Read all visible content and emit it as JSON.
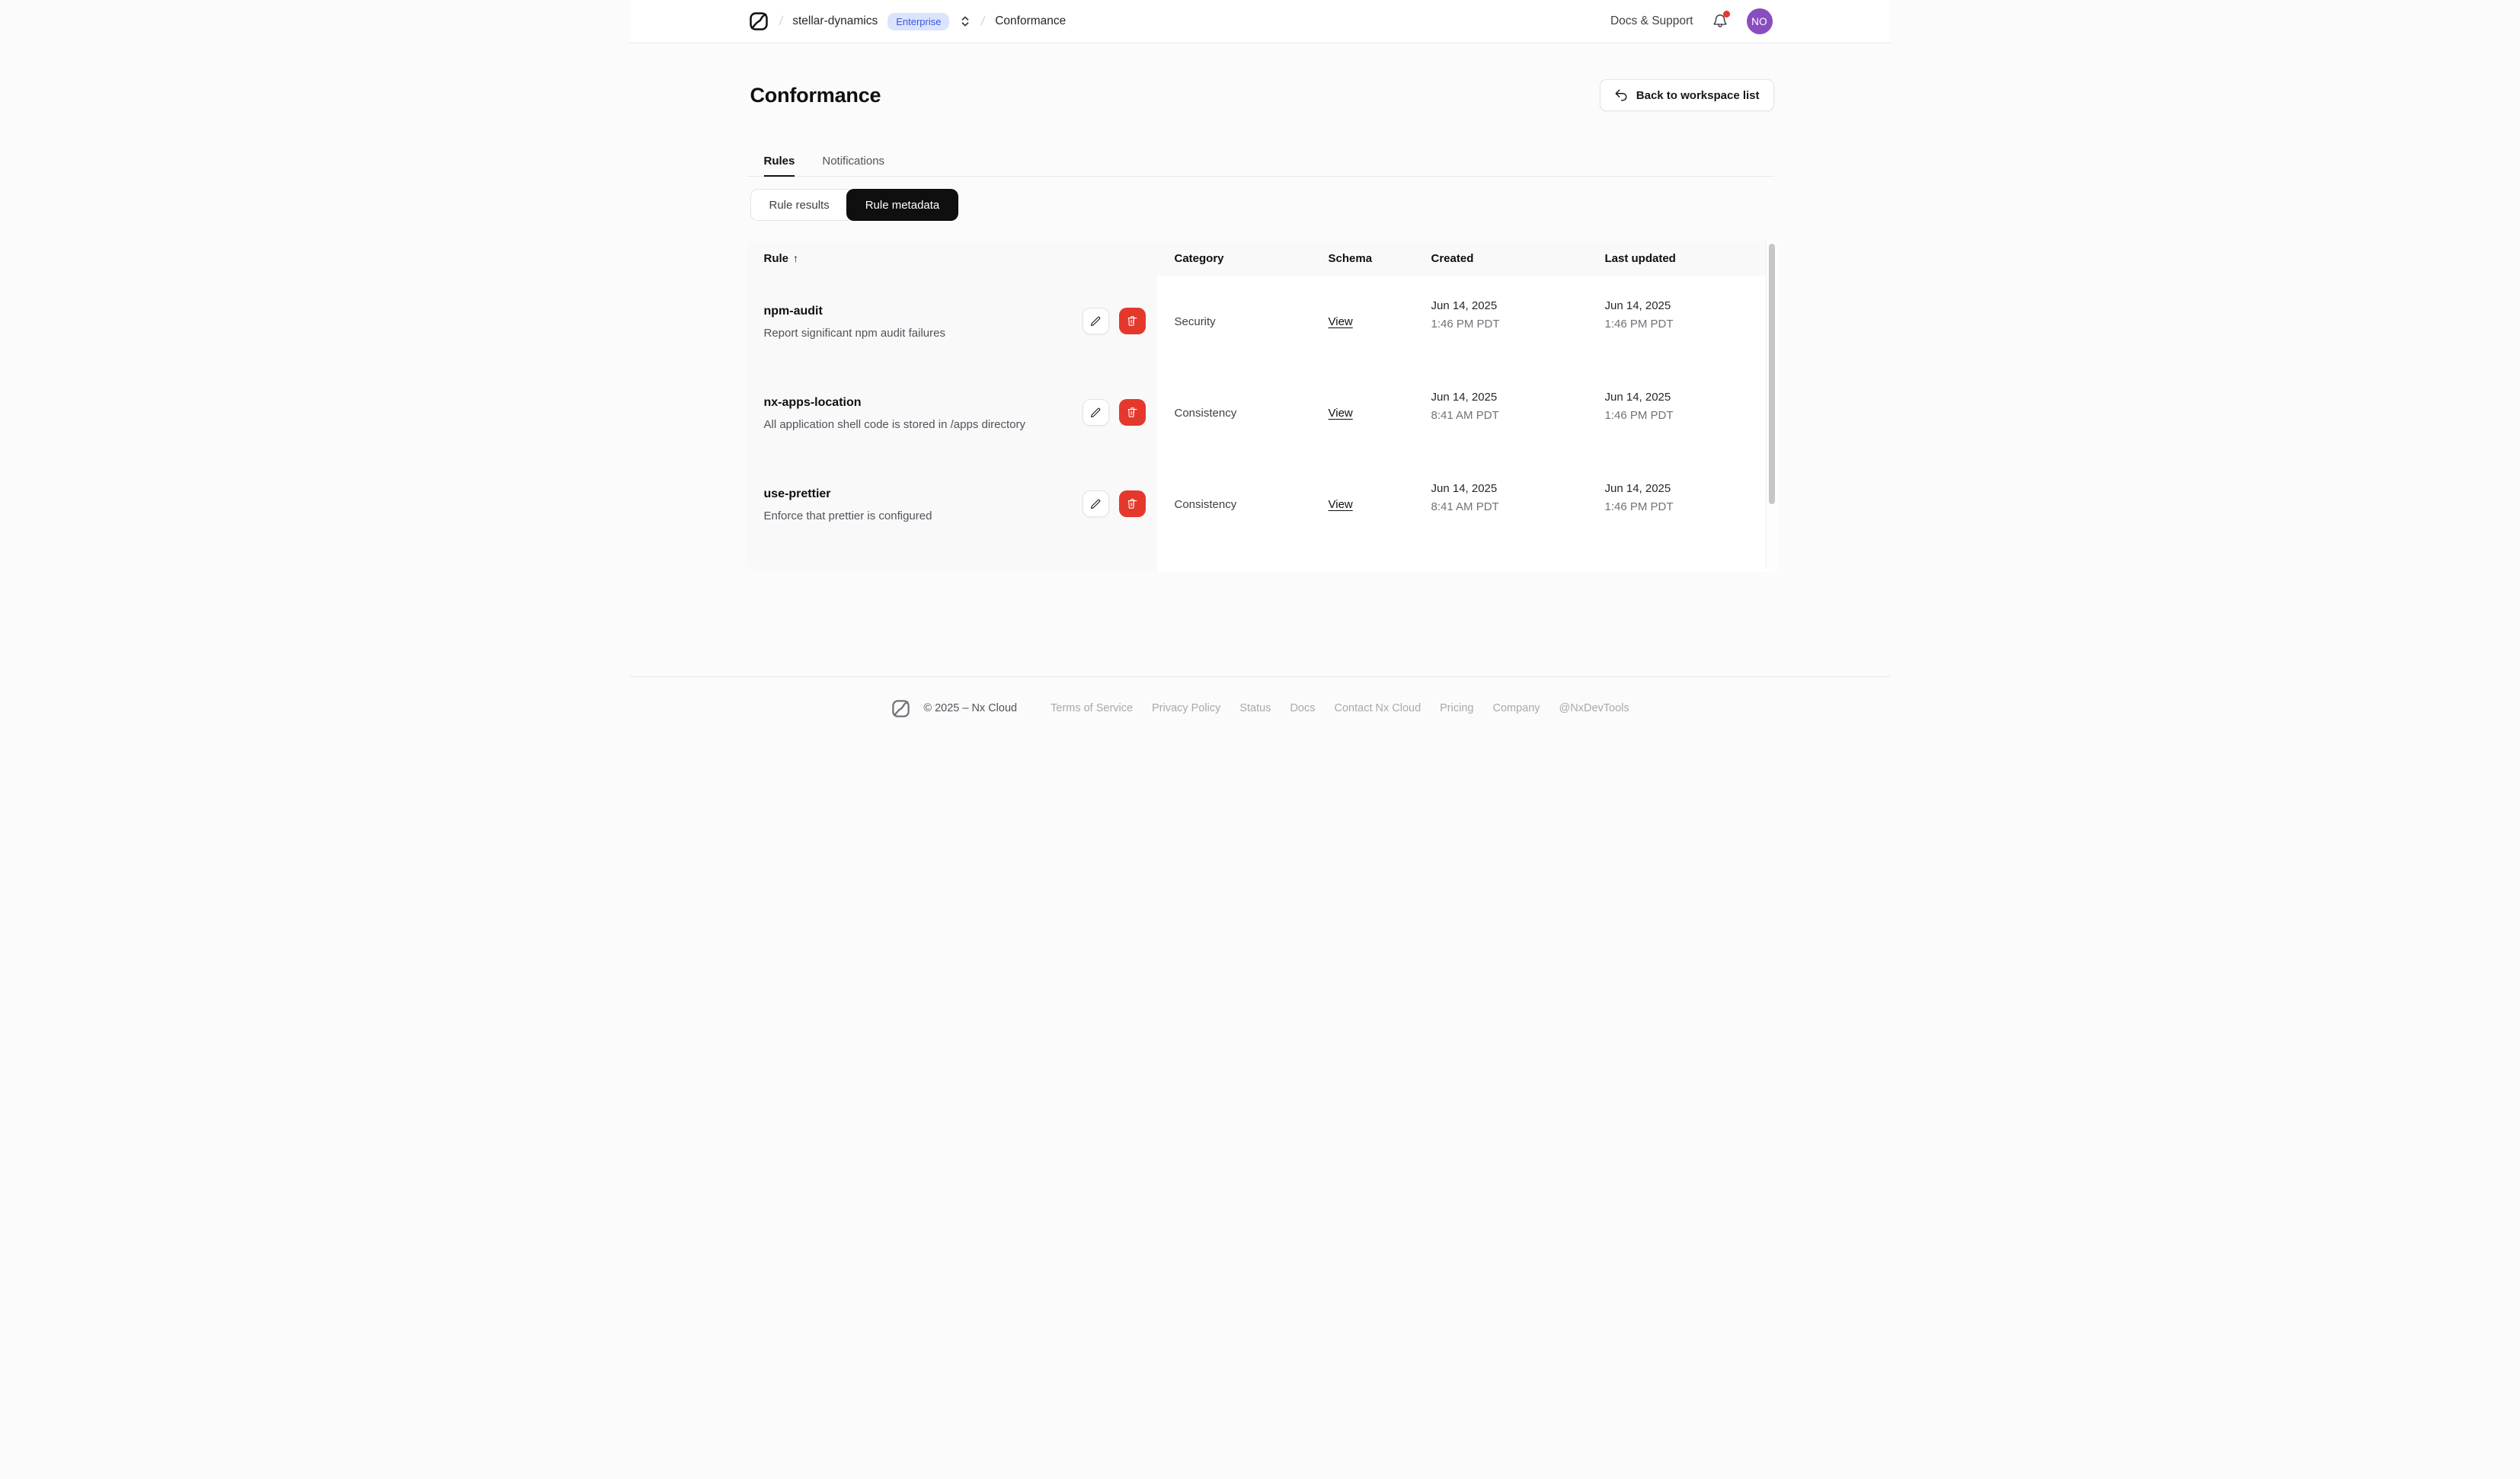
{
  "navbar": {
    "workspace": "stellar-dynamics",
    "badge": "Enterprise",
    "separator1": "/",
    "separator2": "/",
    "page": "Conformance",
    "docs_support": "Docs & Support",
    "avatar_initials": "NO"
  },
  "page": {
    "title": "Conformance",
    "back_button": "Back to workspace list"
  },
  "tabs": {
    "rules": "Rules",
    "notifications": "Notifications"
  },
  "toggle": {
    "results": "Rule results",
    "metadata": "Rule metadata"
  },
  "table": {
    "columns": [
      "Rule",
      "Category",
      "Schema",
      "Created",
      "Last updated"
    ],
    "sort_arrow": "↑",
    "view_label": "View",
    "rows": [
      {
        "name": "npm-audit",
        "description": "Report significant npm audit failures",
        "category": "Security",
        "created_date": "Jun 14, 2025",
        "created_time": "1:46 PM PDT",
        "updated_date": "Jun 14, 2025",
        "updated_time": "1:46 PM PDT"
      },
      {
        "name": "nx-apps-location",
        "description": "All application shell code is stored in /apps directory",
        "category": "Consistency",
        "created_date": "Jun 14, 2025",
        "created_time": "8:41 AM PDT",
        "updated_date": "Jun 14, 2025",
        "updated_time": "1:46 PM PDT"
      },
      {
        "name": "use-prettier",
        "description": "Enforce that prettier is configured",
        "category": "Consistency",
        "created_date": "Jun 14, 2025",
        "created_time": "8:41 AM PDT",
        "updated_date": "Jun 14, 2025",
        "updated_time": "1:46 PM PDT"
      }
    ]
  },
  "footer": {
    "copyright": "© 2025 – Nx Cloud",
    "links": [
      "Terms of Service",
      "Privacy Policy",
      "Status",
      "Docs",
      "Contact Nx Cloud",
      "Pricing",
      "Company",
      "@NxDevTools"
    ]
  },
  "colors": {
    "badge_bg": "#dbe4fd",
    "badge_text": "#3c56dd",
    "delete_red": "#e5382d",
    "avatar_purple": "#8a4dbf",
    "notification_dot": "#e5382d",
    "active_toggle_bg": "#0f0f10"
  }
}
